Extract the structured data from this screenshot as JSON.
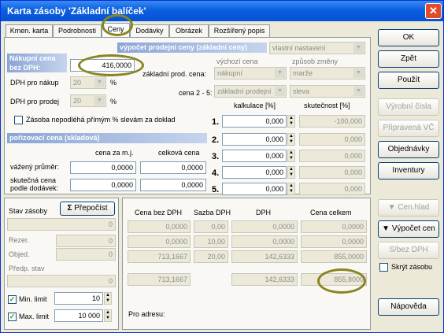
{
  "window": {
    "title": "Karta zásoby 'Základní balíček'",
    "close_glyph": "✕"
  },
  "tabs": [
    "Kmen. karta",
    "Podrobnosti",
    "Ceny",
    "Dodávky",
    "Obrázek",
    "Rozšířený popis"
  ],
  "buttons": {
    "ok": "OK",
    "zpet": "Zpět",
    "pouzit": "Použít",
    "vyrobni_cisla": "Výrobní čísla",
    "pripravena_vc": "Připravená VČ",
    "objednavky": "Objednávky",
    "inventury": "Inventury",
    "cen_hlad": "Cen.hlad",
    "vypocet_cen": "Výpočet cen",
    "s_bez_dph": "S/bez DPH",
    "napoveda": "Nápověda",
    "prepocist": "Přepočíst"
  },
  "chk_glyph": "✓",
  "sigma_glyph": "Σ",
  "pct": "%",
  "arrow_down": "▼",
  "arrow_up": "▲",
  "dropdown_arrow": "▼",
  "skryt_zasobu": "Skrýt zásobu",
  "nakupni": {
    "label": "Nákupní cena bez DPH:",
    "value": "416,0000",
    "dph_nakup_label": "DPH pro nákup",
    "dph_nakup": "20",
    "dph_prodej_label": "DPH pro prodej",
    "dph_prodej": "20",
    "zasoba_label": "Zásoba nepodléhá přímým % slevám za doklad"
  },
  "vypocet": {
    "title": "výpočet prodejní ceny (základní ceny)",
    "title_sel": "vlastní nastavení",
    "col_vychozi": "výchozí cena",
    "col_zpusob": "způsob změny",
    "row_zakladni": "základní prod. cena:",
    "row_zakladni_vychozi": "nákupní",
    "row_zakladni_zpusob": "marže",
    "row_cena25": "cena 2 - 5:",
    "row_cena25_vychozi": "základní prodejní",
    "row_cena25_zpusob": "sleva",
    "kalkulace_label": "kalkulace [%]",
    "skutecnost_label": "skutečnost [%]",
    "rows": [
      {
        "n": "1.",
        "kalk": "0,000",
        "skut": "-100,000"
      },
      {
        "n": "2.",
        "kalk": "0,000",
        "skut": "0,000"
      },
      {
        "n": "3.",
        "kalk": "0,000",
        "skut": "0,000"
      },
      {
        "n": "4.",
        "kalk": "0,000",
        "skut": "0,000"
      },
      {
        "n": "5.",
        "kalk": "0,000",
        "skut": "0,000"
      }
    ]
  },
  "porizovaci": {
    "title": "pořizovací cena (skladová)",
    "col_mj": "cena za m.j.",
    "col_celkova": "celková cena",
    "vazeny": "vážený průměr:",
    "skutecna": "skutečná cena podle dodávek:",
    "vazeny_mj": "0,0000",
    "vazeny_celk": "0,0000",
    "skut_mj": "0,0000",
    "skut_celk": "0,0000"
  },
  "stav": {
    "stav_label": "Stav zásoby",
    "stav_val": "0",
    "rezer_label": "Rezer.",
    "rezer_val": "0",
    "objed_label": "Objed.",
    "objed_val": "0",
    "predp_label": "Předp. stav",
    "predp_val": "0",
    "min_label": "Min. limit",
    "min_val": "10",
    "max_label": "Max. limit",
    "max_val": "10 000"
  },
  "summary": {
    "headers": [
      "Cena bez DPH",
      "Sazba DPH",
      "DPH",
      "Cena celkem"
    ],
    "rows": [
      [
        "0,0000",
        "0,00",
        "0,0000",
        "0,0000"
      ],
      [
        "0,0000",
        "10,00",
        "0,0000",
        "0,0000"
      ],
      [
        "713,1667",
        "20,00",
        "142,6333",
        "855,0000"
      ]
    ],
    "total": [
      "713,1667",
      "142,6333",
      "855,8000"
    ],
    "adresa": "Pro adresu:"
  }
}
